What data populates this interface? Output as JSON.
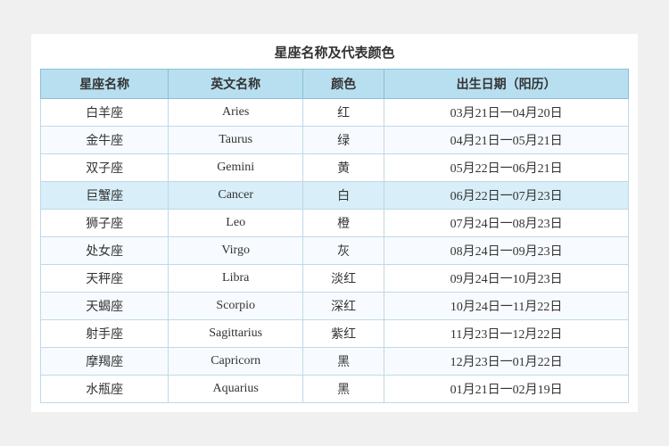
{
  "title": "星座名称及代表颜色",
  "table": {
    "headers": [
      "星座名称",
      "英文名称",
      "颜色",
      "出生日期（阳历）"
    ],
    "rows": [
      {
        "chinese": "白羊座",
        "english": "Aries",
        "color": "红",
        "dates": "03月21日一04月20日"
      },
      {
        "chinese": "金牛座",
        "english": "Taurus",
        "color": "绿",
        "dates": "04月21日一05月21日"
      },
      {
        "chinese": "双子座",
        "english": "Gemini",
        "color": "黄",
        "dates": "05月22日一06月21日"
      },
      {
        "chinese": "巨蟹座",
        "english": "Cancer",
        "color": "白",
        "dates": "06月22日一07月23日"
      },
      {
        "chinese": "狮子座",
        "english": "Leo",
        "color": "橙",
        "dates": "07月24日一08月23日"
      },
      {
        "chinese": "处女座",
        "english": "Virgo",
        "color": "灰",
        "dates": "08月24日一09月23日"
      },
      {
        "chinese": "天秤座",
        "english": "Libra",
        "color": "淡红",
        "dates": "09月24日一10月23日"
      },
      {
        "chinese": "天蝎座",
        "english": "Scorpio",
        "color": "深红",
        "dates": "10月24日一11月22日"
      },
      {
        "chinese": "射手座",
        "english": "Sagittarius",
        "color": "紫红",
        "dates": "11月23日一12月22日"
      },
      {
        "chinese": "摩羯座",
        "english": "Capricorn",
        "color": "黑",
        "dates": "12月23日一01月22日"
      },
      {
        "chinese": "水瓶座",
        "english": "Aquarius",
        "color": "黑",
        "dates": "01月21日一02月19日"
      }
    ]
  }
}
